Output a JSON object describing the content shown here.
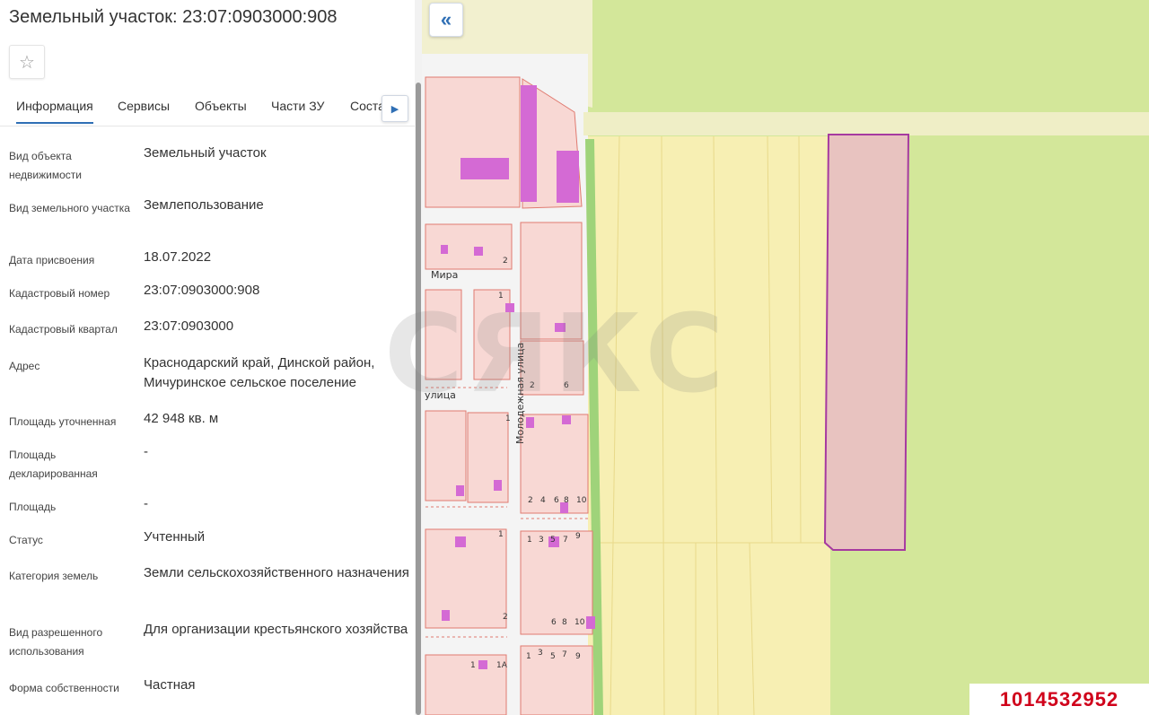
{
  "header": {
    "title": "Земельный участок: 23:07:0903000:908",
    "favorite_icon": "star-outline-icon"
  },
  "tabs": [
    "Информация",
    "Сервисы",
    "Объекты",
    "Части ЗУ",
    "Соста"
  ],
  "active_tab": "Информация",
  "info": [
    {
      "label": "Вид объекта недвижимости",
      "value": "Земельный участок"
    },
    {
      "label": "Вид земельного участка",
      "value": "Землепользование"
    },
    {
      "label": "Дата присвоения",
      "value": "18.07.2022"
    },
    {
      "label": "Кадастровый номер",
      "value": "23:07:0903000:908"
    },
    {
      "label": "Кадастровый квартал",
      "value": "23:07:0903000"
    },
    {
      "label": "Адрес",
      "value": "Краснодарский край, Динской район, Мичуринское сельское поселение"
    },
    {
      "label": "Площадь уточненная",
      "value": "42 948 кв. м"
    },
    {
      "label": "Площадь декларированная",
      "value": "-"
    },
    {
      "label": "Площадь",
      "value": "-"
    },
    {
      "label": "Статус",
      "value": "Учтенный"
    },
    {
      "label": "Категория земель",
      "value": "Земли сельскохозяйственного назначения"
    },
    {
      "label": "Вид разрешенного использования",
      "value": "Для организации крестьянского хозяйства"
    },
    {
      "label": "Форма собственности",
      "value": "Частная"
    }
  ],
  "map": {
    "streets": [
      "Мира",
      "Молодежная улица",
      "улица"
    ],
    "house_numbers": [
      "2",
      "1",
      "2",
      "6",
      "1",
      "2",
      "4",
      "6",
      "8",
      "10",
      "1",
      "1",
      "3",
      "5",
      "7",
      "9",
      "2",
      "6",
      "8",
      "10",
      "1",
      "1А",
      "1",
      "3",
      "5",
      "7",
      "9"
    ],
    "watermark": "СЯКС",
    "colors": {
      "field": "#d3e79a",
      "plots": "#f7efb3",
      "selected_parcel": "#e8c3c0",
      "selected_border": "#a63aa0",
      "buildings": "#d46ad4"
    }
  },
  "listing_id": "1014532952",
  "icons": {
    "collapse": "double-chevron-left-icon",
    "tab_scroll": "chevron-right-icon"
  }
}
